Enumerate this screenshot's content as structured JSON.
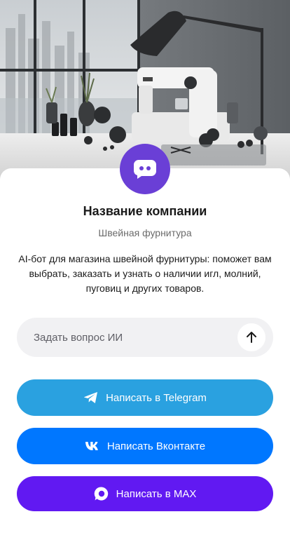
{
  "company": {
    "name": "Название компании",
    "subtitle": "Швейная фурнитура",
    "description": "AI-бот для магазина швейной фурнитуры: поможет вам выбрать, заказать и узнать о наличии игл, молний, пуговиц и других товаров."
  },
  "ask": {
    "placeholder": "Задать вопрос ИИ"
  },
  "buttons": {
    "telegram": "Написать в Telegram",
    "vk": "Написать Вконтакте",
    "max": "Написать в MAX"
  },
  "icons": {
    "logo": "chat-bot-icon",
    "send": "arrow-up-icon",
    "telegram": "telegram-icon",
    "vk": "vk-icon",
    "max": "max-icon"
  },
  "colors": {
    "logo": "#6a3fd6",
    "telegram": "#2aa1e0",
    "vk": "#0077ff",
    "max": "#6119f2",
    "input_bg": "#f1f1f3"
  }
}
